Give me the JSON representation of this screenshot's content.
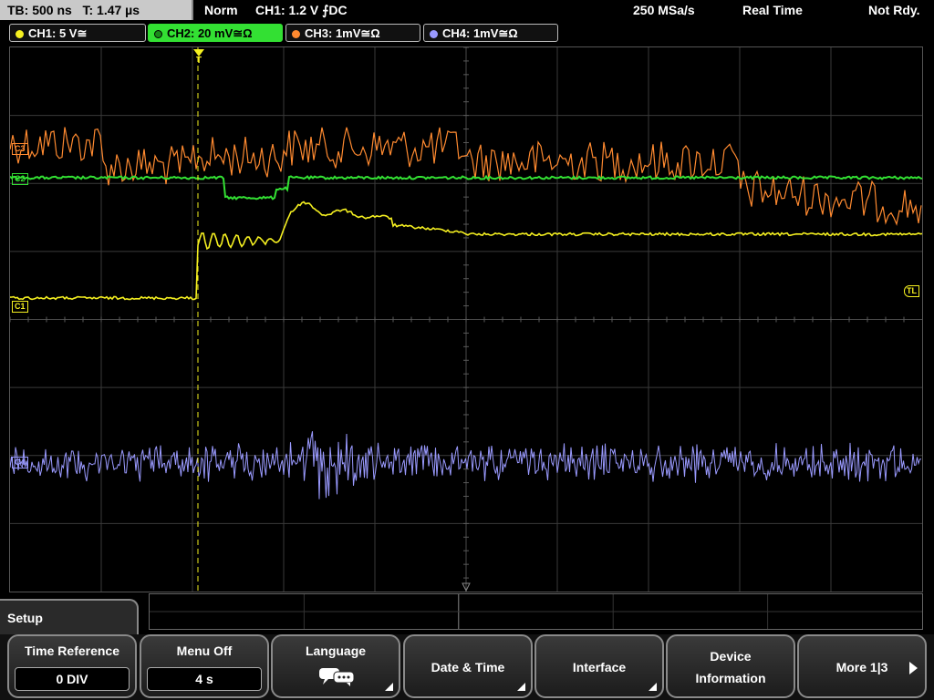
{
  "status_bar": {
    "timebase": "TB: 500 ns",
    "trigger_time": "T: 1.47 µs",
    "mode": "Norm",
    "trigger": "CH1: 1.2 V ⨍DC",
    "sample_rate": "250 MSa/s",
    "acq_mode": "Real Time",
    "ready_state": "Not Rdy."
  },
  "channels": [
    {
      "label": "CH1: 5 V≅",
      "color": "#f5f020"
    },
    {
      "label": "CH2: 20 mV≅Ω",
      "color": "#33e033"
    },
    {
      "label": "CH3: 1mV≅Ω",
      "color": "#ff8a30"
    },
    {
      "label": "CH4: 1mV≅Ω",
      "color": "#9a9aff"
    }
  ],
  "markers": {
    "trigger_position": "T",
    "trigger_level": "TL",
    "ch1": "C1",
    "ch2": "C2",
    "ch3": "C3",
    "ch4": "C4"
  },
  "menu": {
    "title": "Setup",
    "softkeys": [
      {
        "label": "Time Reference",
        "value": "0 DIV"
      },
      {
        "label": "Menu Off",
        "value": "4 s"
      },
      {
        "label": "Language",
        "icon": "speech-bubbles-icon"
      },
      {
        "label": "Date & Time"
      },
      {
        "label": "Interface"
      },
      {
        "label": "Device",
        "label2": "Information"
      },
      {
        "label": "More 1|3"
      }
    ]
  }
}
